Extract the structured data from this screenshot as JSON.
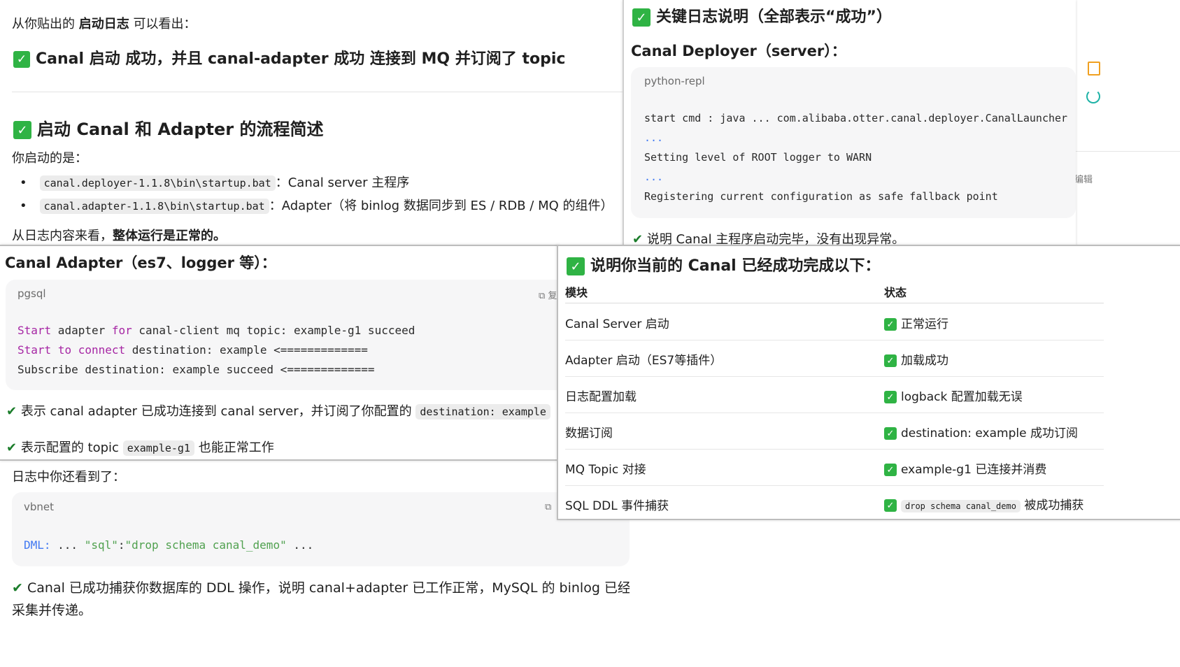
{
  "bg_panel": {
    "intro_prefix": "从你贴出的 ",
    "intro_bold": "启动日志",
    "intro_suffix": " 可以看出：",
    "headline": "Canal 启动 成功，并且 canal-adapter 成功 连接到 MQ 并订阅了 topic",
    "section_title": "启动 Canal 和 Adapter 的流程简述",
    "started_label": "你启动的是：",
    "bullets": [
      {
        "code": "canal.deployer-1.1.8\\bin\\startup.bat",
        "text": "：Canal server 主程序"
      },
      {
        "code": "canal.adapter-1.1.8\\bin\\startup.bat",
        "text": "：Adapter（将 binlog 数据同步到 ES / RDB / MQ 的组件）"
      }
    ],
    "summary_prefix": "从日志内容来看，",
    "summary_bold": "整体运行是正常的。",
    "log_seen": "日志中你还看到了：",
    "vbnet_lang": "vbnet",
    "dml_key": "DML:",
    "dml_mid": " ... ",
    "dml_str1": "\"sql\"",
    "dml_colon": ":",
    "dml_str2": "\"drop schema canal_demo\"",
    "dml_end": " ...",
    "final_line1": "Canal 已成功捕获你数据库的 DDL 操作，说明 canal+adapter 已工作正常，MySQL 的 binlog 已经被",
    "final_line2": "采集并传递。"
  },
  "deployer_panel": {
    "title": "关键日志说明（全部表示“成功”）",
    "subtitle": "Canal Deployer（server）：",
    "lang": "python-repl",
    "lines": [
      "start cmd : java ... com.alibaba.otter.canal.deployer.CanalLauncher",
      "...",
      "Setting level of ROOT logger to WARN",
      "...",
      "Registering current configuration as safe fallback point"
    ],
    "note": "说明 Canal 主程序启动完毕，没有出现异常。",
    "edge_text": "编辑"
  },
  "adapter_panel": {
    "title": "Canal Adapter（es7、logger 等）：",
    "lang": "pgsql",
    "copy_label": "复",
    "line1": {
      "kw1": "Start",
      "t1": " adapter ",
      "kw2": "for",
      "t2": " canal-client mq topic: example-g1 succeed"
    },
    "line2": {
      "kw1": "Start",
      "t1": " ",
      "kw2": "to",
      "t2": " ",
      "kw3": "connect",
      "t3": " destination: example <============="
    },
    "line3": "Subscribe destination: example succeed <=============",
    "note1_text": "表示 canal adapter 已成功连接到 canal server，并订阅了你配置的",
    "note1_chip": "destination: example",
    "note2_prefix": "表示配置的 topic",
    "note2_chip": "example-g1",
    "note2_suffix": "也能正常工作"
  },
  "table_panel": {
    "title": "说明你当前的 Canal 已经成功完成以下：",
    "col_module": "模块",
    "col_status": "状态",
    "rows": [
      {
        "module": "Canal Server 启动",
        "status": "正常运行"
      },
      {
        "module": "Adapter 启动（ES7等插件）",
        "status": "加载成功"
      },
      {
        "module": "日志配置加载",
        "status": "logback 配置加载无误"
      },
      {
        "module": "数据订阅",
        "status": "destination: example 成功订阅"
      },
      {
        "module": "MQ Topic 对接",
        "status": "example-g1 已连接并消费"
      },
      {
        "module": "SQL DDL 事件捕获",
        "status_chip": "drop schema canal_demo",
        "status": "被成功捕获"
      }
    ]
  },
  "colors": {
    "check_green": "#2fb344",
    "tick_green": "#1b7d2b",
    "keyword": "#a626a4",
    "string": "#50a14f",
    "key": "#4078f2"
  }
}
